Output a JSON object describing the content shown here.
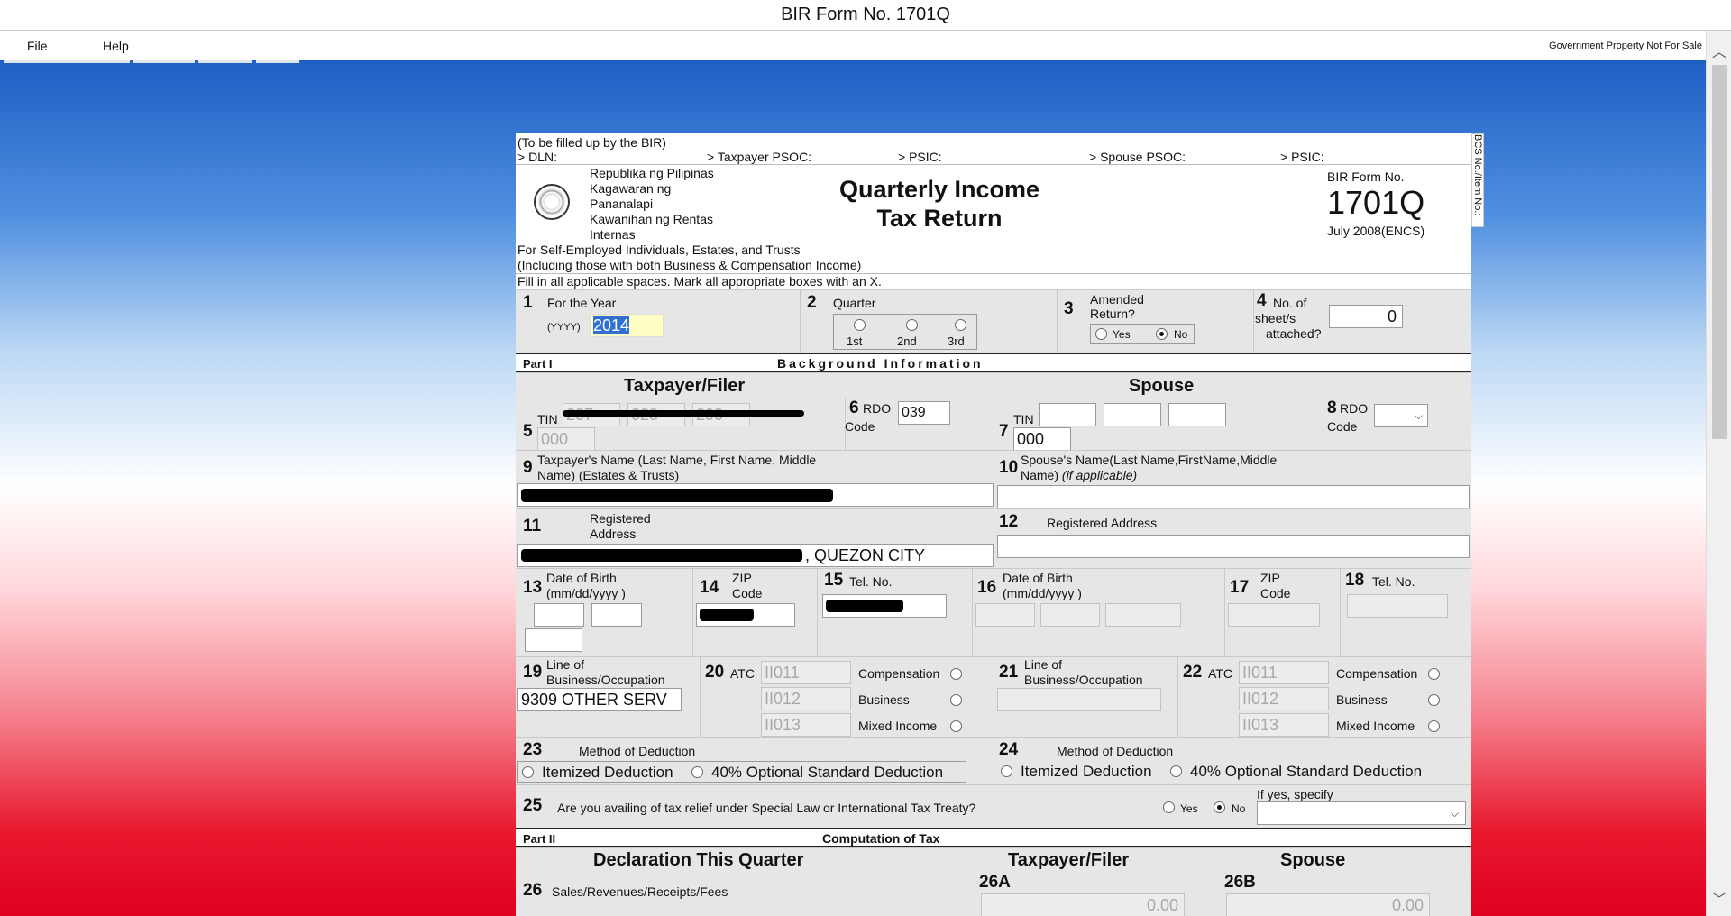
{
  "window": {
    "title": "BIR Form No. 1701Q"
  },
  "menu": {
    "file": "File",
    "help": "Help",
    "notice": "Government Property Not For Sale"
  },
  "header": {
    "fill_note": "(To be filled up by the BIR)",
    "dln": "> DLN:",
    "taxpayer_psoc": "> Taxpayer PSOC:",
    "psic1": "> PSIC:",
    "spouse_psoc": "> Spouse PSOC:",
    "psic2": "> PSIC:",
    "bcs": "BCS No./Item No.:",
    "agency_lines": [
      "Republika ng Pilipinas",
      "Kagawaran ng",
      "Pananalapi",
      "Kawanihan ng Rentas",
      "Internas"
    ],
    "title_line1": "Quarterly Income",
    "title_line2": "Tax Return",
    "form_no_label": "BIR Form No.",
    "form_no": "1701Q",
    "form_date": "July 2008(ENCS)",
    "sub1": "For Self-Employed Individuals, Estates, and Trusts",
    "sub2": "(Including those with both Business & Compensation Income)",
    "instructions": "Fill in all applicable spaces. Mark all appropriate boxes with an X."
  },
  "row1": {
    "n1": "1",
    "year_label": "For the Year",
    "yyyy": "(YYYY)",
    "year_value": "2014",
    "n2": "2",
    "quarter_label": "Quarter",
    "q1": "1st",
    "q2": "2nd",
    "q3": "3rd",
    "n3": "3",
    "amended_label1": "Amended",
    "amended_label2": "Return?",
    "yes": "Yes",
    "no": "No",
    "n4": "4",
    "sheets_label1": "No. of",
    "sheets_label2": "sheet/s",
    "sheets_label3": "attached?",
    "sheets_value": "0"
  },
  "part1": {
    "label": "Part I",
    "title": "Background Information",
    "taxpayer": "Taxpayer/Filer",
    "spouse": "Spouse"
  },
  "tin": {
    "n5": "5",
    "tin_label": "TIN",
    "tin1": "207",
    "tin2": "028",
    "tin3": "290",
    "tin4": "000",
    "n6": "6",
    "rdo_label": "RDO",
    "code_label": "Code",
    "rdo_value": "039",
    "n7": "7",
    "spouse_tin4": "000",
    "n8": "8"
  },
  "names": {
    "n9": "9",
    "name_label1": "Taxpayer's Name (Last Name, First Name, Middle",
    "name_label2": "Name) (Estates & Trusts)",
    "n10": "10",
    "spouse_name_label1": "Spouse's Name(Last Name,FirstName,Middle",
    "spouse_name_label2": "Name) ",
    "if_applicable": "(if applicable)"
  },
  "address": {
    "n11": "11",
    "reg1": "Registered",
    "reg2": "Address",
    "address_suffix": ", QUEZON CITY",
    "n12": "12",
    "spouse_reg": "Registered Address"
  },
  "dob": {
    "n13": "13",
    "dob1": "Date of Birth",
    "dob2": "(mm/dd/yyyy )",
    "n14": "14",
    "zip1": "ZIP",
    "zip2": "Code",
    "n15": "15",
    "tel": "Tel. No.",
    "n16": "16",
    "n17": "17",
    "n18": "18"
  },
  "lob": {
    "n19": "19",
    "lob1": "Line of",
    "lob2": "Business/Occupation",
    "lob_value": "9309 OTHER SERV",
    "n20": "20",
    "atc": "ATC",
    "atc1": "II011",
    "atc2": "II012",
    "atc3": "II013",
    "comp": "Compensation",
    "biz": "Business",
    "mixed": "Mixed Income",
    "n21": "21",
    "n22": "22"
  },
  "method": {
    "n23": "23",
    "label": "Method of Deduction",
    "itemized": "Itemized Deduction",
    "osd": "40% Optional Standard Deduction",
    "n24": "24"
  },
  "relief": {
    "n25": "25",
    "question": "Are you availing of tax relief under Special Law or International Tax Treaty?",
    "yes": "Yes",
    "no": "No",
    "specify": "If yes, specify"
  },
  "part2": {
    "label": "Part II",
    "title": "Computation of Tax",
    "decl": "Declaration This Quarter",
    "taxpayer": "Taxpayer/Filer",
    "spouse": "Spouse",
    "n26": "26",
    "sales": "Sales/Revenues/Receipts/Fees",
    "a26": "26A",
    "b26": "26B",
    "v26a": "0.00",
    "v26b": "0.00"
  }
}
